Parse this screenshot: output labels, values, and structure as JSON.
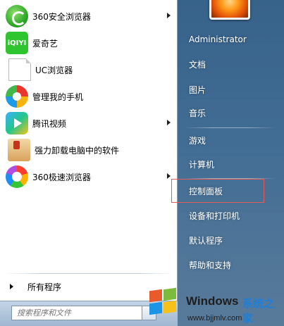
{
  "programs": [
    {
      "label": "360安全浏览器",
      "icon": "360-safe-browser-icon",
      "has_submenu": true
    },
    {
      "label": "爱奇艺",
      "icon": "iqiyi-icon",
      "icon_text": "iQIYI",
      "has_submenu": false
    },
    {
      "label": "UC浏览器",
      "icon": "blank-document-icon",
      "has_submenu": false
    },
    {
      "label": "管理我的手机",
      "icon": "phone-manager-icon",
      "has_submenu": false
    },
    {
      "label": "腾讯视频",
      "icon": "tencent-video-icon",
      "has_submenu": true
    },
    {
      "label": "强力卸载电脑中的软件",
      "icon": "uninstall-icon",
      "has_submenu": false
    },
    {
      "label": "360极速浏览器",
      "icon": "360-speed-browser-icon",
      "has_submenu": true
    }
  ],
  "all_programs_label": "所有程序",
  "search": {
    "placeholder": "搜索程序和文件"
  },
  "right_panel": {
    "user": "Administrator",
    "group1": [
      "文档",
      "图片",
      "音乐"
    ],
    "group2": [
      "游戏",
      "计算机"
    ],
    "group3": [
      "控制面板",
      "设备和打印机",
      "默认程序",
      "帮助和支持"
    ]
  },
  "highlighted_item": "控制面板",
  "colors": {
    "right_pane": "#2f5b86",
    "highlight_border": "#e25a5a",
    "watermark_accent": "#1f7fd8"
  },
  "watermark": {
    "title": "Windows",
    "subtitle": "系统之家",
    "url": "www.bjjmlv.com"
  }
}
